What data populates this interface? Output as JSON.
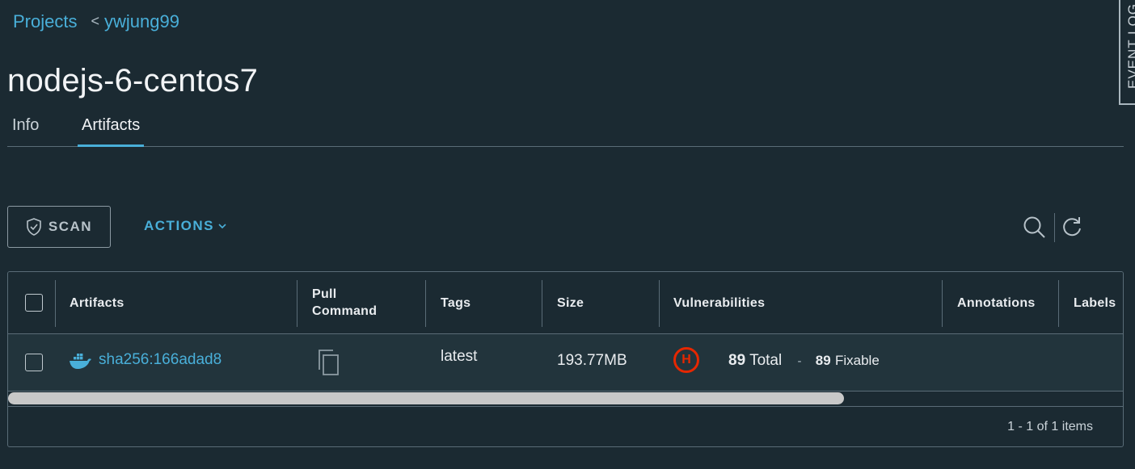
{
  "breadcrumb": {
    "projects": "Projects",
    "separator": "<",
    "project": "ywjung99"
  },
  "page": {
    "title": "nodejs-6-centos7"
  },
  "tabs": [
    {
      "label": "Info"
    },
    {
      "label": "Artifacts"
    }
  ],
  "event_log": {
    "label": "EVENT LOG"
  },
  "toolbar": {
    "scan_label": "SCAN",
    "actions_label": "ACTIONS"
  },
  "table": {
    "columns": [
      "Artifacts",
      "Pull Command",
      "Tags",
      "Size",
      "Vulnerabilities",
      "Annotations",
      "Labels"
    ],
    "pull_command_line1": "Pull",
    "pull_command_line2": "Command",
    "rows": [
      {
        "digest": "sha256:166adad8",
        "tags": "latest",
        "size": "193.77MB",
        "severity": "H",
        "total": "89",
        "total_label": "Total",
        "separator": "-",
        "fixable": "89",
        "fixable_label": "Fixable"
      }
    ],
    "pagination": "1 - 1 of 1 items"
  },
  "colors": {
    "accent": "#49afd9",
    "high_severity": "#e62700",
    "background": "#1b2a32"
  }
}
